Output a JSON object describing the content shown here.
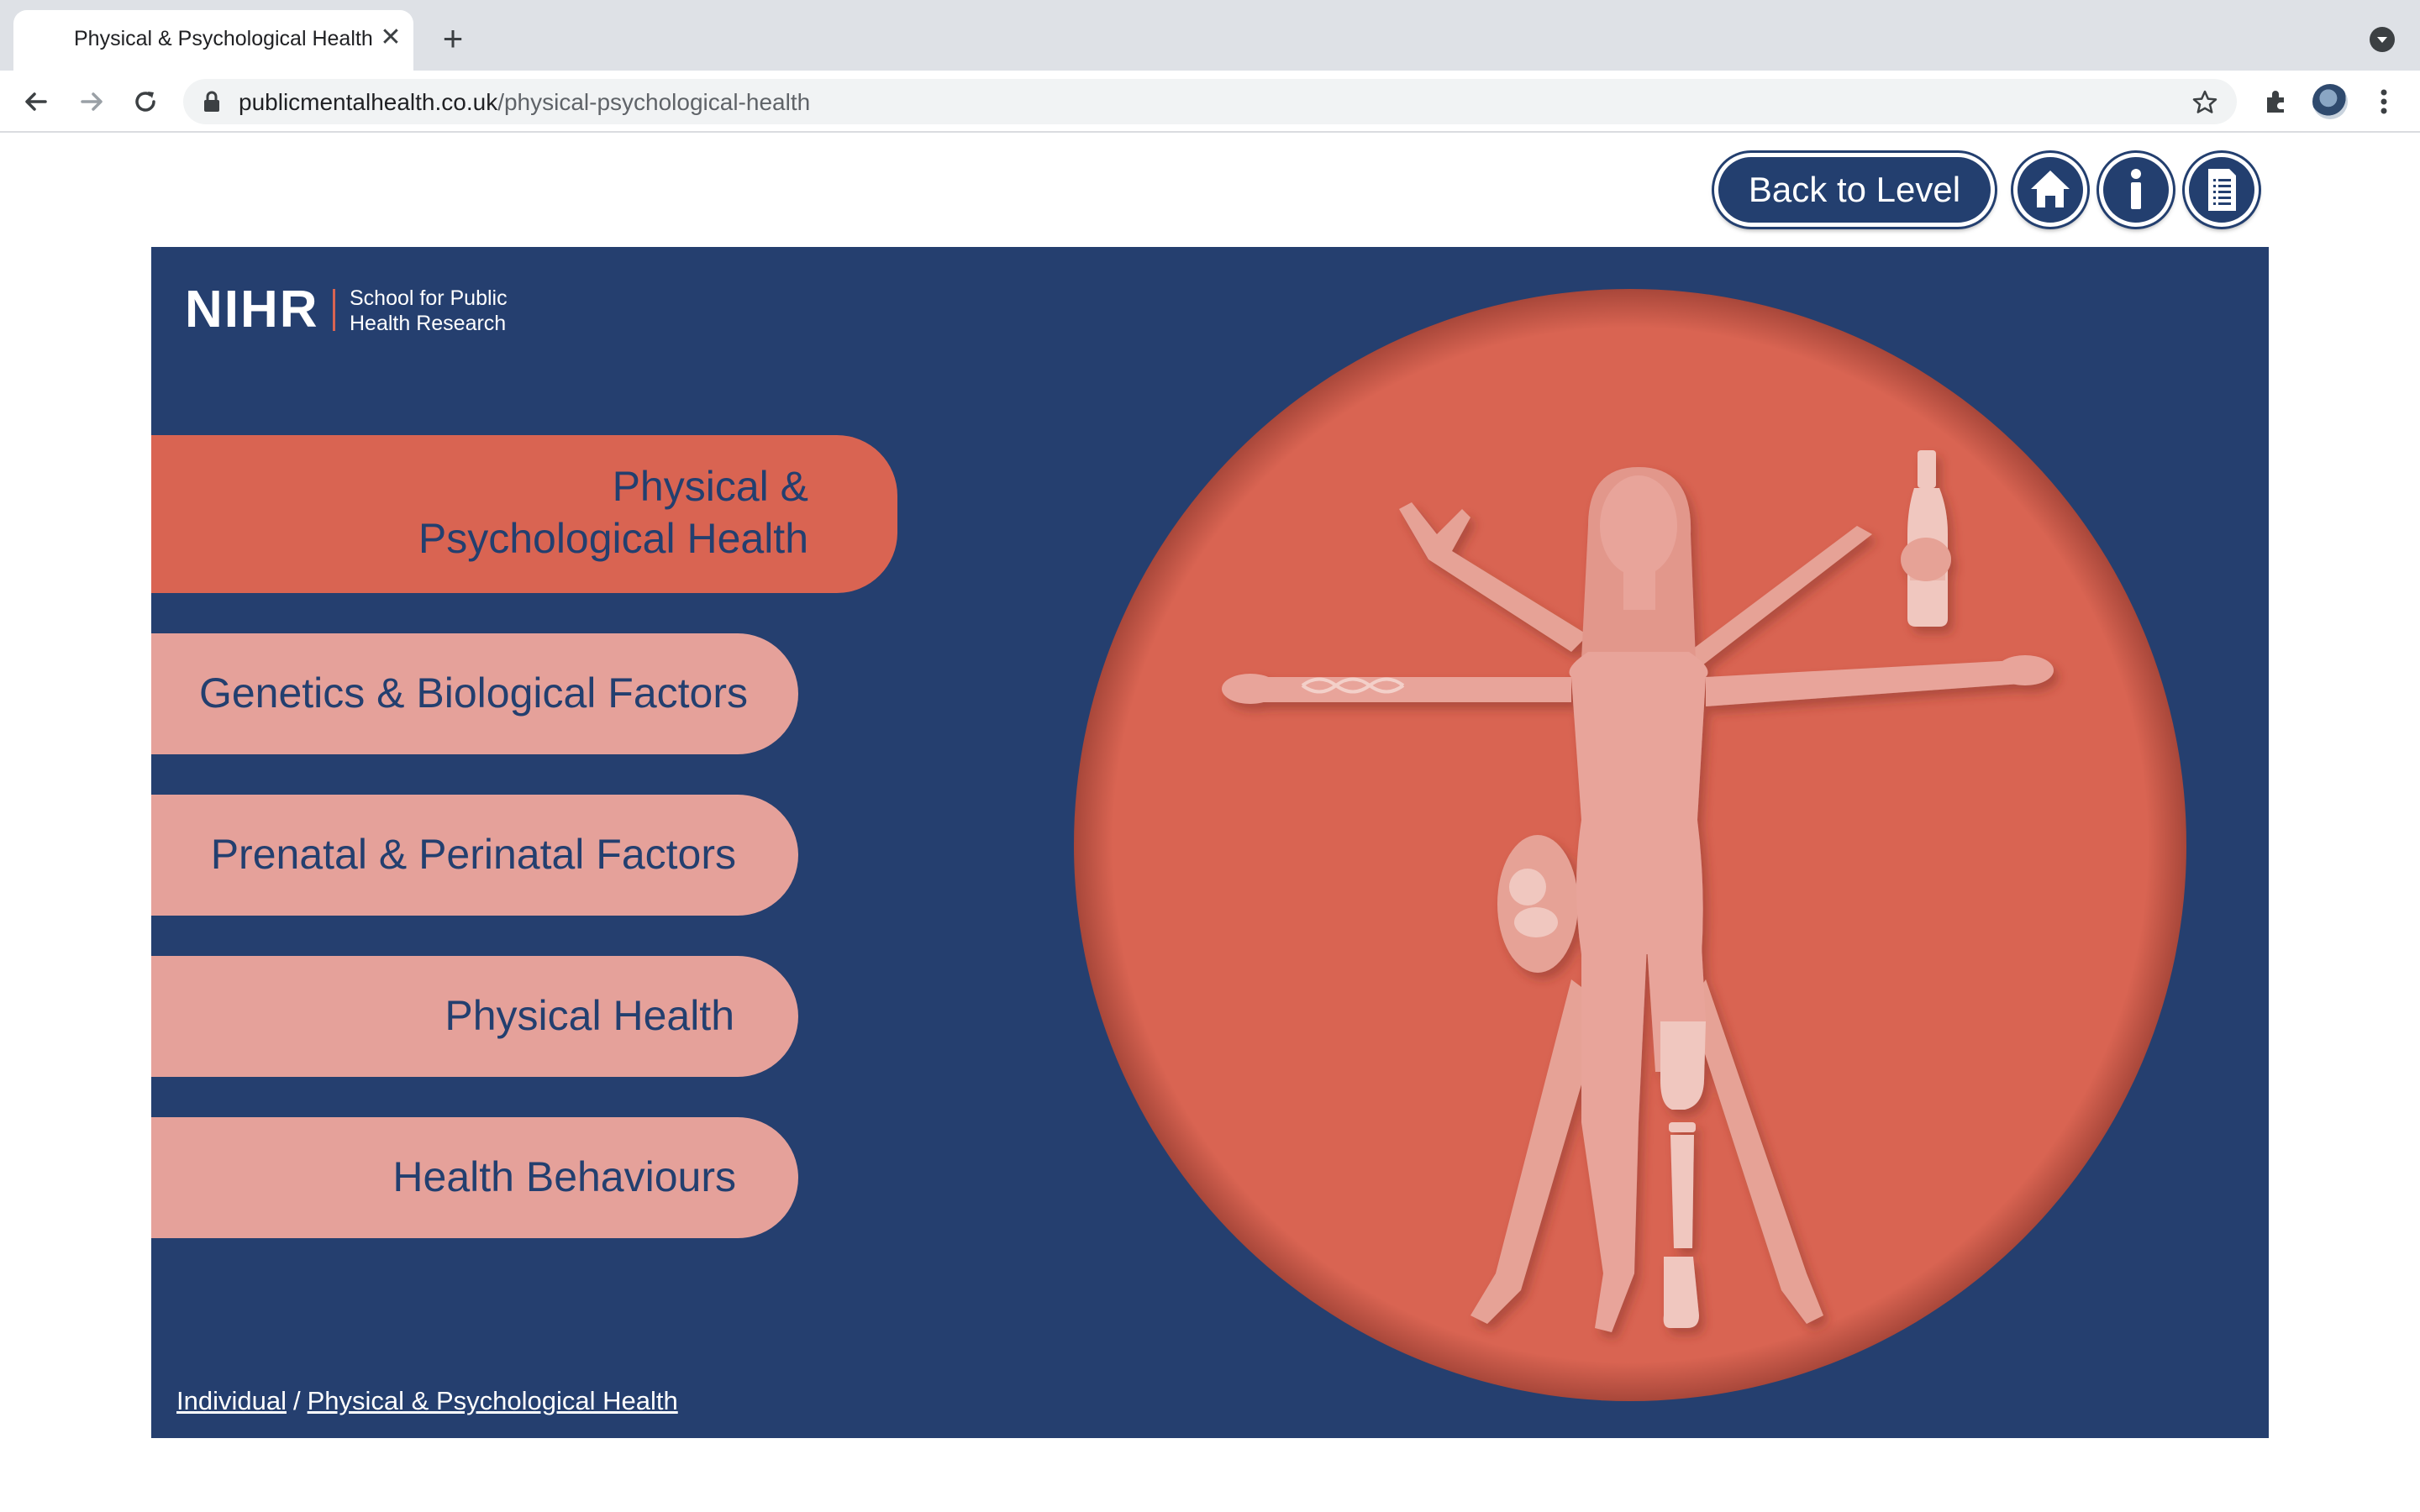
{
  "browser": {
    "tab_title": "Physical & Psychological Health",
    "tab_close": "✕",
    "new_tab": "+",
    "url_domain": "publicmentalhealth.co.uk",
    "url_path": "/physical-psychological-health"
  },
  "header": {
    "back_label": "Back to Level"
  },
  "logo": {
    "main": "NIHR",
    "sub_line1": "School for Public",
    "sub_line2": "Health Research"
  },
  "menu": {
    "items": [
      {
        "line1": "Physical &",
        "line2": "Psychological Health",
        "active": true
      },
      {
        "label": "Genetics & Biological Factors"
      },
      {
        "label": "Prenatal & Perinatal Factors"
      },
      {
        "label": "Physical Health"
      },
      {
        "label": "Health Behaviours"
      }
    ]
  },
  "breadcrumb": {
    "level": "Individual",
    "separator": "/",
    "current": "Physical & Psychological Health"
  },
  "colors": {
    "navy": "#253f6f",
    "coral": "#d96452",
    "pink": "#e5a19a"
  },
  "icons": [
    "home-icon",
    "info-icon",
    "document-list-icon",
    "search-tabs-icon",
    "star-icon",
    "extensions-icon",
    "lock-icon"
  ]
}
